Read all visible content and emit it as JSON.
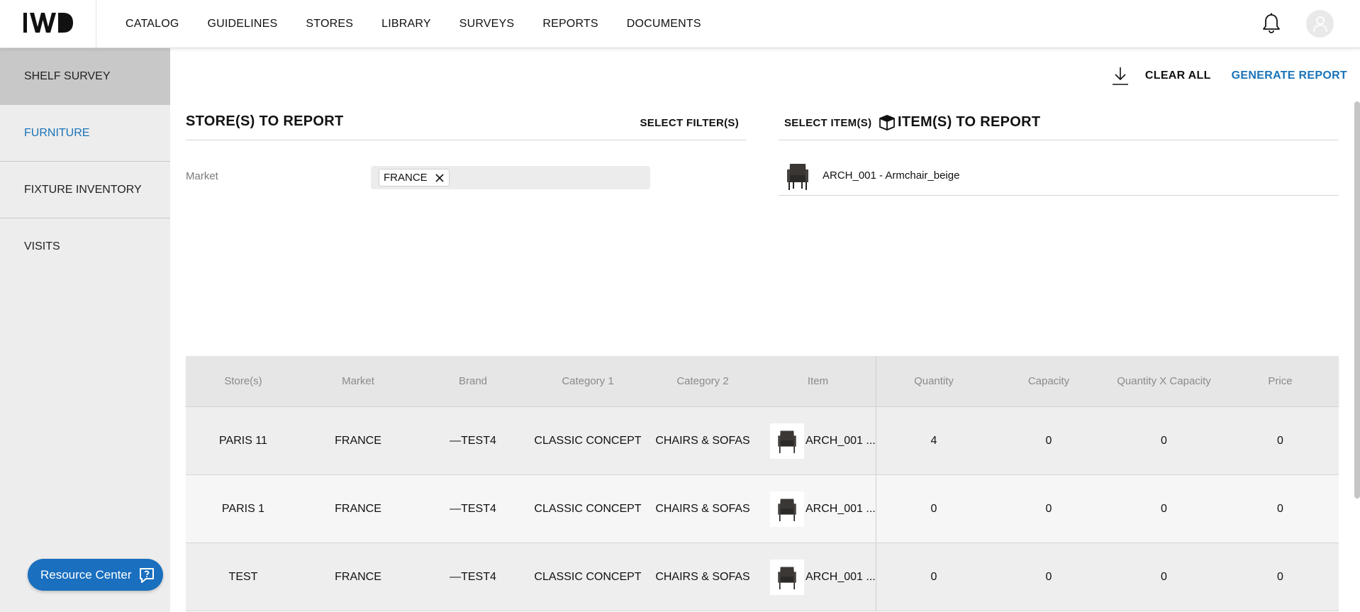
{
  "nav": {
    "logo_text": "IWD",
    "items": [
      "CATALOG",
      "GUIDELINES",
      "STORES",
      "LIBRARY",
      "SURVEYS",
      "REPORTS",
      "DOCUMENTS"
    ]
  },
  "sidebar": {
    "items": [
      {
        "label": "SHELF SURVEY"
      },
      {
        "label": "FURNITURE"
      },
      {
        "label": "FIXTURE INVENTORY"
      },
      {
        "label": "VISITS"
      }
    ],
    "resource_center": "Resource Center"
  },
  "actions": {
    "clear_all": "CLEAR ALL",
    "generate_report": "GENERATE REPORT"
  },
  "stores_panel": {
    "title": "STORE(S) TO REPORT",
    "select_label": "SELECT FILTER(S)",
    "market_label": "Market",
    "market_chip": "FRANCE"
  },
  "items_panel": {
    "title": "ITEM(S) TO REPORT",
    "select_label": "SELECT ITEM(S)",
    "item": "ARCH_001 - Armchair_beige"
  },
  "table": {
    "headers": [
      "Store(s)",
      "Market",
      "Brand",
      "Category 1",
      "Category 2",
      "Item",
      "Quantity",
      "Capacity",
      "Quantity X Capacity",
      "Price"
    ],
    "rows": [
      {
        "store": "PARIS 11",
        "market": "FRANCE",
        "brand": "—TEST4",
        "cat1": "CLASSIC CONCEPT",
        "cat2": "CHAIRS & SOFAS",
        "item": "ARCH_001 ...",
        "qty": "4",
        "cap": "0",
        "qxc": "0",
        "price": "0"
      },
      {
        "store": "PARIS 1",
        "market": "FRANCE",
        "brand": "—TEST4",
        "cat1": "CLASSIC CONCEPT",
        "cat2": "CHAIRS & SOFAS",
        "item": "ARCH_001 ...",
        "qty": "0",
        "cap": "0",
        "qxc": "0",
        "price": "0"
      },
      {
        "store": "TEST",
        "market": "FRANCE",
        "brand": "—TEST4",
        "cat1": "CLASSIC CONCEPT",
        "cat2": "CHAIRS & SOFAS",
        "item": "ARCH_001 ...",
        "qty": "0",
        "cap": "0",
        "qxc": "0",
        "price": "0"
      }
    ]
  },
  "colors": {
    "accent": "#1a73b8",
    "resource_button": "#1a6fbf",
    "sidebar_bg": "#ededed",
    "sidebar_active": "#c8c8c8"
  }
}
